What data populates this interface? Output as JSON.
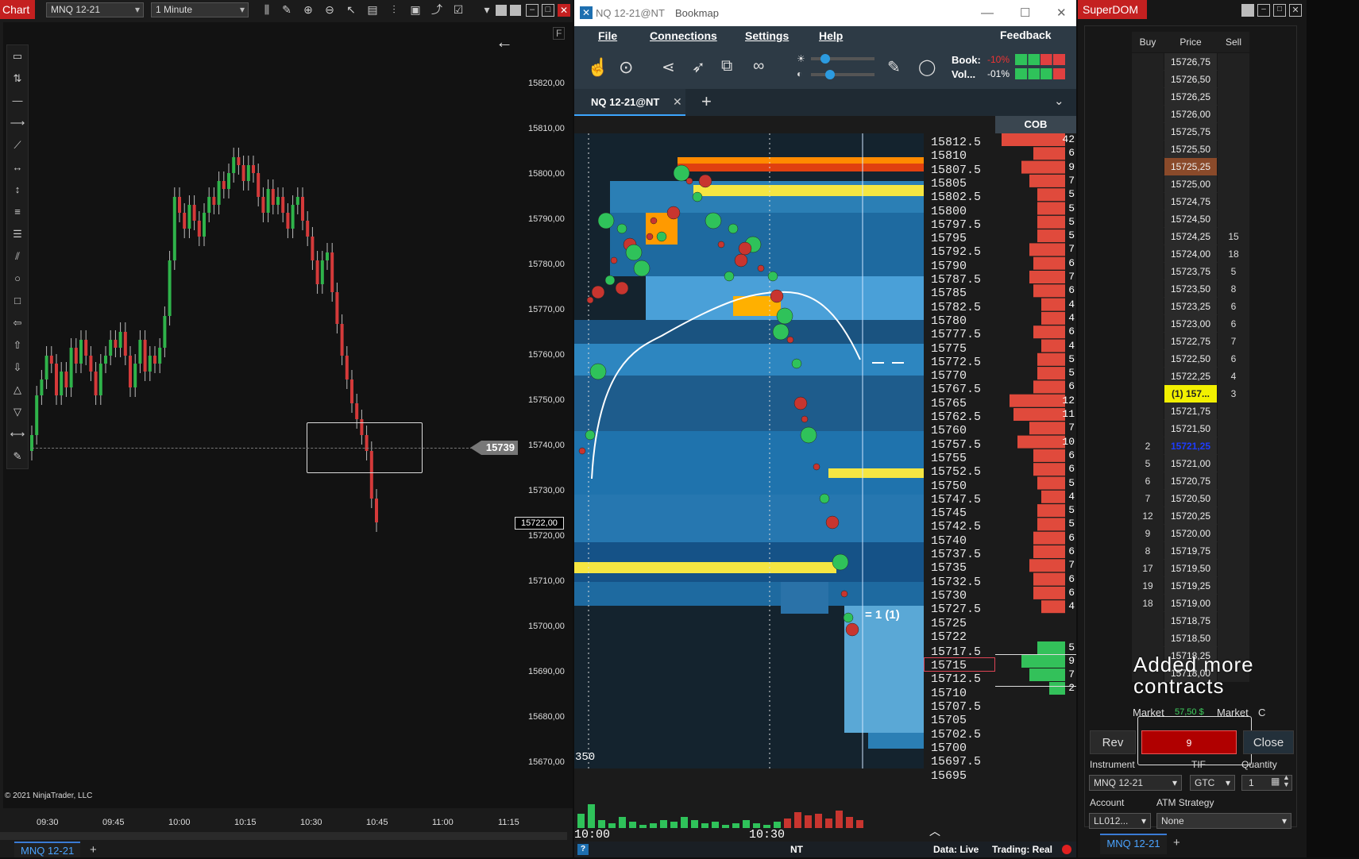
{
  "chart": {
    "title": "Chart",
    "instrument": "MNQ 12-21",
    "interval": "1 Minute",
    "copyright": "© 2021 NinjaTrader, LLC",
    "f_label": "F",
    "price_levels": [
      "15820,00",
      "15810,00",
      "15800,00",
      "15790,00",
      "15780,00",
      "15770,00",
      "15760,00",
      "15750,00",
      "15740,00",
      "15730,00",
      "15720,00",
      "15710,00",
      "15700,00",
      "15690,00",
      "15680,00",
      "15670,00"
    ],
    "time_labels": [
      "09:30",
      "09:45",
      "10:00",
      "10:15",
      "10:30",
      "10:45",
      "11:00",
      "11:15"
    ],
    "marker_price": "15739",
    "last_price": "15722,00",
    "tab": "MNQ 12-21",
    "add_tab": "+",
    "colors": {
      "up": "#2fb34a",
      "down": "#d43a3a"
    }
  },
  "bookmap": {
    "window_title": "NQ 12-21@NT",
    "app_title": "Bookmap",
    "menu": [
      "File",
      "Connections",
      "Settings",
      "Help"
    ],
    "feedback": "Feedback",
    "book_label": "Book:",
    "book_value": "-10%",
    "vol_label": "Vol...",
    "vol_value": "-01%",
    "tab": "NQ 12-21@NT",
    "add_tab": "+",
    "cob_label": "COB",
    "prices": [
      "15812.5",
      "15810",
      "15807.5",
      "15805",
      "15802.5",
      "15800",
      "15797.5",
      "15795",
      "15792.5",
      "15790",
      "15787.5",
      "15785",
      "15782.5",
      "15780",
      "15777.5",
      "15775",
      "15772.5",
      "15770",
      "15767.5",
      "15765",
      "15762.5",
      "15760",
      "15757.5",
      "15755",
      "15752.5",
      "15750",
      "15747.5",
      "15745",
      "15742.5",
      "15740",
      "15737.5",
      "15735",
      "15732.5",
      "15730",
      "15727.5",
      "15725",
      "15722",
      "15717.5",
      "15715",
      "15712.5",
      "15710",
      "15707.5",
      "15705",
      "15702.5",
      "15700",
      "15697.5",
      "15695"
    ],
    "current_price": "15722",
    "position_marker": "= 1 (1)",
    "cob_values": [
      "42",
      "6",
      "9",
      "7",
      "5",
      "5",
      "5",
      "5",
      "7",
      "6",
      "7",
      "6",
      "4",
      "4",
      "6",
      "4",
      "5",
      "5",
      "6",
      "12",
      "11",
      "7",
      "10",
      "6",
      "6",
      "5",
      "4",
      "5",
      "5",
      "6",
      "6",
      "7",
      "6",
      "6",
      "4",
      "5",
      "9",
      "7",
      "2"
    ],
    "volume_max": "350",
    "time_labels": [
      "10:00",
      "10:30"
    ],
    "status": {
      "source": "NT",
      "data": "Data: Live",
      "trading": "Trading: Real"
    }
  },
  "superdom": {
    "title": "SuperDOM",
    "headers": {
      "buy": "Buy",
      "price": "Price",
      "sell": "Sell"
    },
    "rows": [
      {
        "buy": "",
        "price": "15726,75",
        "sell": ""
      },
      {
        "buy": "",
        "price": "15726,50",
        "sell": ""
      },
      {
        "buy": "",
        "price": "15726,25",
        "sell": ""
      },
      {
        "buy": "",
        "price": "15726,00",
        "sell": ""
      },
      {
        "buy": "",
        "price": "15725,75",
        "sell": ""
      },
      {
        "buy": "",
        "price": "15725,50",
        "sell": ""
      },
      {
        "buy": "",
        "price": "15725,25",
        "sell": ""
      },
      {
        "buy": "",
        "price": "15725,00",
        "sell": ""
      },
      {
        "buy": "",
        "price": "15724,75",
        "sell": ""
      },
      {
        "buy": "",
        "price": "15724,50",
        "sell": ""
      },
      {
        "buy": "",
        "price": "15724,25",
        "sell": "15"
      },
      {
        "buy": "",
        "price": "15724,00",
        "sell": "18"
      },
      {
        "buy": "",
        "price": "15723,75",
        "sell": "5"
      },
      {
        "buy": "",
        "price": "15723,50",
        "sell": "8"
      },
      {
        "buy": "",
        "price": "15723,25",
        "sell": "6"
      },
      {
        "buy": "",
        "price": "15723,00",
        "sell": "6"
      },
      {
        "buy": "",
        "price": "15722,75",
        "sell": "7"
      },
      {
        "buy": "",
        "price": "15722,50",
        "sell": "6"
      },
      {
        "buy": "",
        "price": "15722,25",
        "sell": "4"
      },
      {
        "buy": "",
        "price": "(1) 157...",
        "sell": "3"
      },
      {
        "buy": "",
        "price": "15721,75",
        "sell": ""
      },
      {
        "buy": "",
        "price": "15721,50",
        "sell": ""
      },
      {
        "buy": "2",
        "price": "15721,25",
        "sell": ""
      },
      {
        "buy": "5",
        "price": "15721,00",
        "sell": ""
      },
      {
        "buy": "6",
        "price": "15720,75",
        "sell": ""
      },
      {
        "buy": "7",
        "price": "15720,50",
        "sell": ""
      },
      {
        "buy": "12",
        "price": "15720,25",
        "sell": ""
      },
      {
        "buy": "9",
        "price": "15720,00",
        "sell": ""
      },
      {
        "buy": "8",
        "price": "15719,75",
        "sell": ""
      },
      {
        "buy": "17",
        "price": "15719,50",
        "sell": ""
      },
      {
        "buy": "19",
        "price": "15719,25",
        "sell": ""
      },
      {
        "buy": "18",
        "price": "15719,00",
        "sell": ""
      },
      {
        "buy": "",
        "price": "15718,75",
        "sell": ""
      },
      {
        "buy": "",
        "price": "15718,50",
        "sell": ""
      },
      {
        "buy": "",
        "price": "15718,25",
        "sell": ""
      },
      {
        "buy": "",
        "price": "15718,00",
        "sell": ""
      }
    ],
    "highlight_price_index": 6,
    "position_index": 19,
    "bid_highlight_index": 22,
    "overlay_text": [
      "Added more",
      "contracts"
    ],
    "market_left": "Market",
    "pnl": "57,50 $",
    "market_right": "Market",
    "c_label": "C",
    "rev": "Rev",
    "position_qty": "9",
    "close": "Close",
    "instrument_label": "Instrument",
    "tif_label": "TIF",
    "quantity_label": "Quantity",
    "instrument": "MNQ 12-21",
    "tif": "GTC",
    "quantity": "1",
    "account_label": "Account",
    "atm_label": "ATM Strategy",
    "account": "LL012...",
    "atm": "None",
    "tab": "MNQ 12-21",
    "add_tab": "+"
  }
}
